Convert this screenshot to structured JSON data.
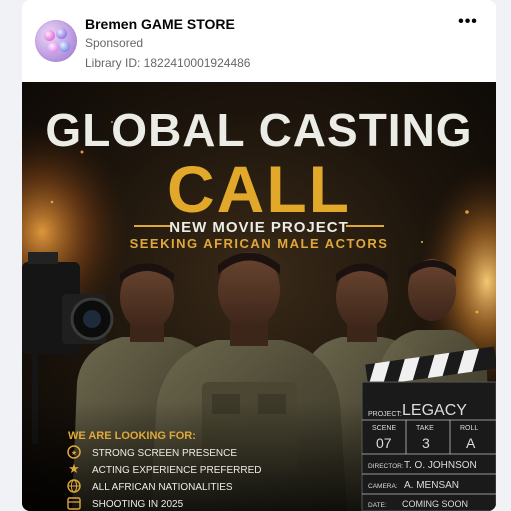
{
  "ad": {
    "page_name": "Bremen GAME STORE",
    "sponsored_label": "Sponsored",
    "library_id": "Library ID: 1822410001924486",
    "more_icon": "more-horizontal-icon",
    "more_glyph": "•••"
  },
  "poster": {
    "title_line1": "GLOBAL CASTING",
    "title_line2": "CALL",
    "subtitle": "NEW MOVIE PROJECT",
    "tagline": "SEEKING AFRICAN MALE ACTORS",
    "looking_for_heading": "WE ARE LOOKING FOR:",
    "requirements": [
      {
        "icon": "star-badge-icon",
        "text": "STRONG SCREEN PRESENCE"
      },
      {
        "icon": "star-icon",
        "text": "ACTING EXPERIENCE PREFERRED"
      },
      {
        "icon": "globe-icon",
        "text": "ALL AFRICAN NATIONALITIES"
      },
      {
        "icon": "calendar-icon",
        "text": "SHOOTING IN 2025"
      }
    ],
    "clapperboard": {
      "project_label": "PROJECT:",
      "project_value": "LEGACY",
      "scene_label": "SCENE",
      "scene_value": "07",
      "take_label": "TAKE",
      "take_value": "3",
      "roll_label": "ROLL",
      "roll_value": "A",
      "director_label": "DIRECTOR:",
      "director_value": "T. O. JOHNSON",
      "camera_label": "CAMERA:",
      "camera_value": "A. MENSAN",
      "date_label": "DATE:",
      "date_value": "COMING SOON"
    },
    "colors": {
      "title_white": "#ecece6",
      "title_gold": "#e2a82a",
      "accent_gold": "#e0a83a",
      "background": "#15100a"
    }
  }
}
